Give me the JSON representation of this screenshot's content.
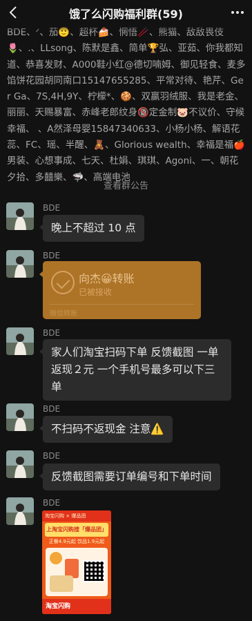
{
  "header": {
    "title": "饿了么闪购福利群(59)"
  },
  "members_text": "BDE、ᐟ、茄🙂、超杯🍰、惘悟🥢、熊猫、敌敌畏伎🌷、.、LLsong、陈默是鑫、简单🏆弘、亚茹、你我都知道、恭喜发财、A000鞋小红@德切喃姆、御见轻食、麦多馅饼花园胡同南口15147655285、平常对待、艳芹、Ger Ga、7S,4H,9Y、柠檬*、🍪、双赢羽绒服、我是老金、丽丽、天赐暴富、赤峰老郎纹身🔞定金制🐷不议价、守候幸福、 、A然泽母婴15847340633、小杨小杨、解语花蕊、FC、瑶、半醒、🧸、Glorious wealth、幸福是福🍎男装、心想事成、七天、杜娟、琪琪、Agoni、一、朝花夕拾、多囍樂、🦈、高端电池",
  "notice": {
    "view_label": "查看",
    "link_label": "群公告"
  },
  "messages": [
    {
      "sender": "BDE",
      "text": "晚上不超过 10 点"
    },
    {
      "sender": "BDE",
      "transfer": {
        "name": "向杰😀转账",
        "status": "已被接收",
        "footer": "微信转账"
      }
    },
    {
      "sender": "BDE",
      "text": "家人们淘宝扫码下单 反馈截图 一单返现２元 一个手机号最多可以下三单"
    },
    {
      "sender": "BDE",
      "text": "不扫码不返现金 注意⚠️"
    },
    {
      "sender": "BDE",
      "text": "反馈截图需要订单编号和下单时间"
    },
    {
      "sender": "BDE",
      "image": {
        "top": "淘宝闪购 × 爆品团",
        "headline": "上淘宝闪购搜「爆品团」",
        "price": "正餐4.9元起 饮品1.9元起",
        "footer": "淘宝闪购"
      }
    }
  ]
}
